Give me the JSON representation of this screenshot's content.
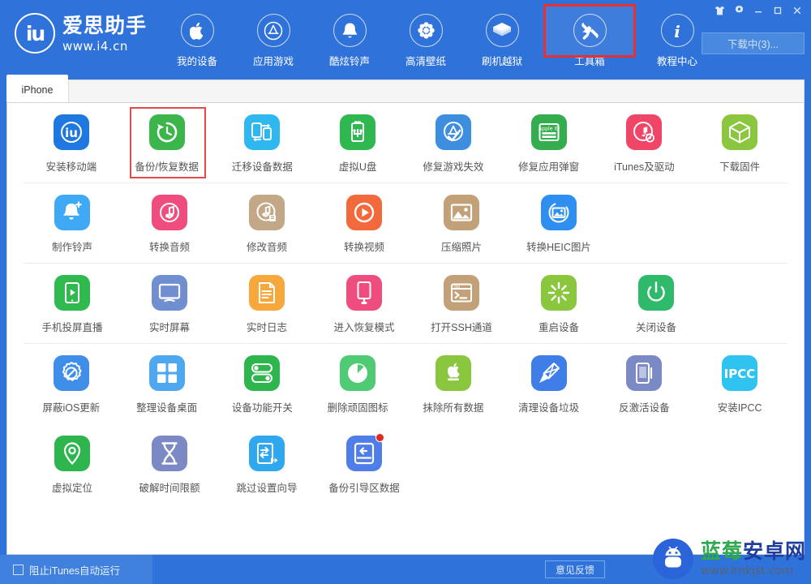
{
  "app": {
    "logo_mark": "iu",
    "logo_title": "爱思助手",
    "logo_url": "www.i4.cn"
  },
  "header": {
    "nav": [
      {
        "label": "我的设备",
        "icon": "apple-icon",
        "active": false
      },
      {
        "label": "应用游戏",
        "icon": "appstore-icon",
        "active": false
      },
      {
        "label": "酷炫铃声",
        "icon": "bell-icon",
        "active": false
      },
      {
        "label": "高清壁纸",
        "icon": "flower-icon",
        "active": false
      },
      {
        "label": "刷机越狱",
        "icon": "box-open-icon",
        "active": false
      },
      {
        "label": "工具箱",
        "icon": "tools-icon",
        "active": true
      },
      {
        "label": "教程中心",
        "icon": "info-icon",
        "active": false
      }
    ],
    "window_buttons": [
      {
        "name": "skin-icon",
        "glyph": "tshirt"
      },
      {
        "name": "settings-gear-icon",
        "glyph": "gear"
      },
      {
        "name": "minimize-button",
        "glyph": "minimize"
      },
      {
        "name": "maximize-button",
        "glyph": "maximize"
      },
      {
        "name": "close-button",
        "glyph": "close"
      }
    ],
    "download_button": "下载中(3)..."
  },
  "tabs": {
    "active": "iPhone",
    "items": [
      "iPhone"
    ]
  },
  "toolbox": {
    "rows": [
      {
        "separator": true,
        "items": [
          {
            "label": "安装移动端",
            "icon": "i4-app-icon",
            "color": "#1f78e0",
            "highlight": false
          },
          {
            "label": "备份/恢复数据",
            "icon": "backup-restore-icon",
            "color": "#3cb54a",
            "highlight": true
          },
          {
            "label": "迁移设备数据",
            "icon": "migrate-data-icon",
            "color": "#2fb8f0",
            "highlight": false
          },
          {
            "label": "虚拟U盘",
            "icon": "usb-drive-icon",
            "color": "#2fb84f",
            "highlight": false
          },
          {
            "label": "修复游戏失效",
            "icon": "fix-game-icon",
            "color": "#3e8ee0",
            "highlight": false
          },
          {
            "label": "修复应用弹窗",
            "icon": "apple-id-icon",
            "color": "#34ad4e",
            "highlight": false
          },
          {
            "label": "iTunes及驱动",
            "icon": "itunes-driver-icon",
            "color": "#ef4668",
            "highlight": false
          },
          {
            "label": "下载固件",
            "icon": "firmware-box-icon",
            "color": "#8bc63f",
            "highlight": false
          }
        ]
      },
      {
        "separator": true,
        "items": [
          {
            "label": "制作铃声",
            "icon": "make-ringtone-icon",
            "color": "#3fa9f5",
            "highlight": false
          },
          {
            "label": "转换音频",
            "icon": "convert-audio-icon",
            "color": "#ef4d7d",
            "highlight": false
          },
          {
            "label": "修改音频",
            "icon": "edit-audio-icon",
            "color": "#c2a887",
            "highlight": false
          },
          {
            "label": "转换视频",
            "icon": "convert-video-icon",
            "color": "#f26a3c",
            "highlight": false
          },
          {
            "label": "压缩照片",
            "icon": "compress-photo-icon",
            "color": "#c2a078",
            "highlight": false
          },
          {
            "label": "转换HEIC图片",
            "icon": "heic-convert-icon",
            "color": "#2f8ff0",
            "highlight": false
          }
        ]
      },
      {
        "separator": true,
        "items": [
          {
            "label": "手机投屏直播",
            "icon": "screen-cast-icon",
            "color": "#2fb94e",
            "highlight": false
          },
          {
            "label": "实时屏幕",
            "icon": "live-screen-icon",
            "color": "#6f8fd0",
            "highlight": false
          },
          {
            "label": "实时日志",
            "icon": "live-log-icon",
            "color": "#f6a83c",
            "highlight": false
          },
          {
            "label": "进入恢复模式",
            "icon": "recovery-mode-icon",
            "color": "#ef4d7d",
            "highlight": false
          },
          {
            "label": "打开SSH通道",
            "icon": "ssh-terminal-icon",
            "color": "#c2a078",
            "highlight": false
          },
          {
            "label": "重启设备",
            "icon": "reboot-icon",
            "color": "#8bc63f",
            "highlight": false
          },
          {
            "label": "关闭设备",
            "icon": "power-off-icon",
            "color": "#2fba6b",
            "highlight": false
          }
        ]
      },
      {
        "separator": false,
        "items": [
          {
            "label": "屏蔽iOS更新",
            "icon": "block-ios-update-icon",
            "color": "#3f8ee8",
            "highlight": false
          },
          {
            "label": "整理设备桌面",
            "icon": "organize-desktop-icon",
            "color": "#4fa8ef",
            "highlight": false
          },
          {
            "label": "设备功能开关",
            "icon": "feature-toggle-icon",
            "color": "#2fb54e",
            "highlight": false
          },
          {
            "label": "删除顽固图标",
            "icon": "remove-icon-icon",
            "color": "#4ecb73",
            "highlight": false
          },
          {
            "label": "抹除所有数据",
            "icon": "erase-all-icon",
            "color": "#8bc63f",
            "highlight": false
          },
          {
            "label": "清理设备垃圾",
            "icon": "clean-junk-icon",
            "color": "#3f7ee8",
            "highlight": false
          },
          {
            "label": "反激活设备",
            "icon": "deactivate-icon",
            "color": "#7b8ac4",
            "highlight": false
          },
          {
            "label": "安装IPCC",
            "icon": "ipcc-icon",
            "color": "#2fc3f0",
            "highlight": false,
            "text": "IPCC"
          }
        ]
      },
      {
        "separator": false,
        "items": [
          {
            "label": "虚拟定位",
            "icon": "virtual-location-icon",
            "color": "#2fb54e",
            "highlight": false
          },
          {
            "label": "破解时间限额",
            "icon": "time-limit-icon",
            "color": "#7b8ac4",
            "highlight": false
          },
          {
            "label": "跳过设置向导",
            "icon": "skip-setup-icon",
            "color": "#2fa8ef",
            "highlight": false
          },
          {
            "label": "备份引导区数据",
            "icon": "backup-boot-icon",
            "color": "#4f7ee8",
            "highlight": false,
            "badge": true
          }
        ]
      }
    ]
  },
  "footer": {
    "block_itunes_label": "阻止iTunes自动运行",
    "block_itunes_checked": false,
    "feedback_label": "意见反馈"
  },
  "watermark": {
    "title_part1": "蓝莓",
    "title_part2": "安卓网",
    "url": "www.lmkjst.com"
  },
  "colors": {
    "brand_blue": "#2f72d9",
    "highlight_red": "#e83030",
    "content_bg": "#ffffff"
  }
}
